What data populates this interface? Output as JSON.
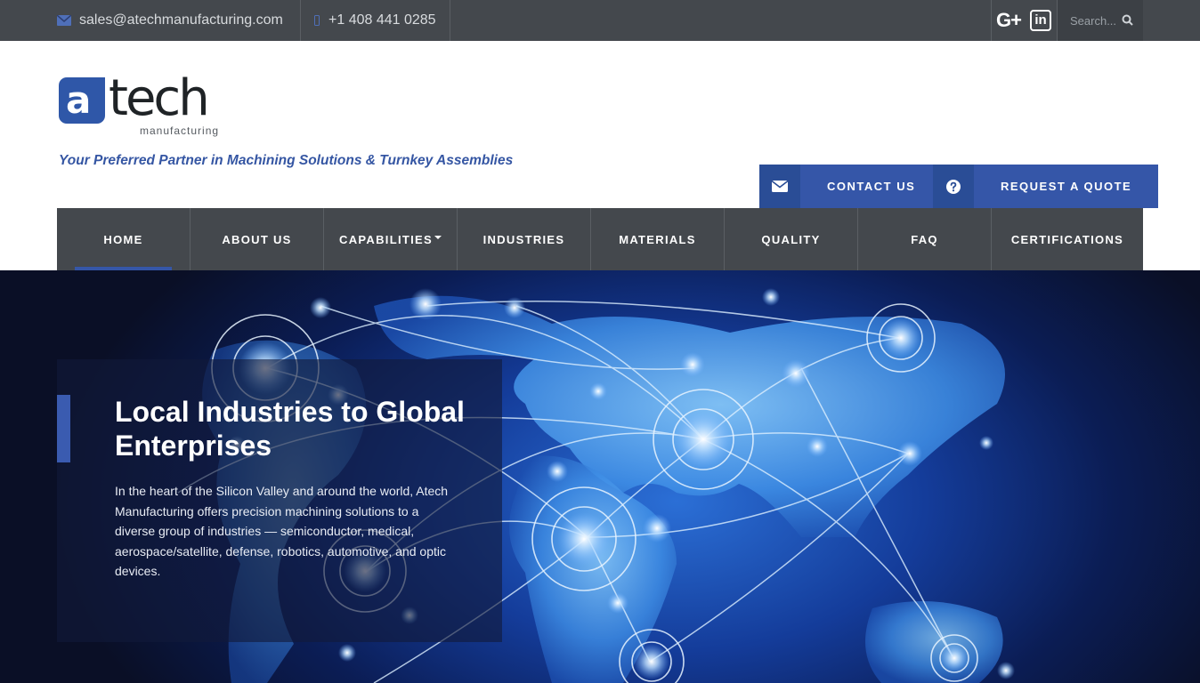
{
  "topbar": {
    "email": "sales@atechmanufacturing.com",
    "phone": "+1 408 441 0285",
    "search_placeholder": "Search...",
    "social": [
      "google-plus",
      "linkedin"
    ],
    "gplus_label": "G+",
    "linkedin_label": "in"
  },
  "header": {
    "logo_mark": "a",
    "logo_word": "tech",
    "logo_sub": "manufacturing",
    "tagline": "Your Preferred Partner in Machining Solutions & Turnkey Assemblies",
    "contact_label": "CONTACT US",
    "quote_label": "REQUEST A QUOTE"
  },
  "nav": {
    "items": [
      "HOME",
      "ABOUT US",
      "CAPABILITIES",
      "INDUSTRIES",
      "MATERIALS",
      "QUALITY",
      "FAQ",
      "CERTIFICATIONS"
    ],
    "active": "HOME"
  },
  "hero": {
    "title": "Local Industries to Global Enterprises",
    "body": "In the heart of the Silicon Valley and around the world, Atech Manufacturing offers precision machining solutions to a diverse group of industries — semiconductor, medical, aerospace/satellite, defense, robotics, automotive, and optic devices."
  },
  "colors": {
    "topbar": "#44484d",
    "accent": "#3556a8",
    "nav": "#44484d",
    "tagline": "#3556a3"
  }
}
